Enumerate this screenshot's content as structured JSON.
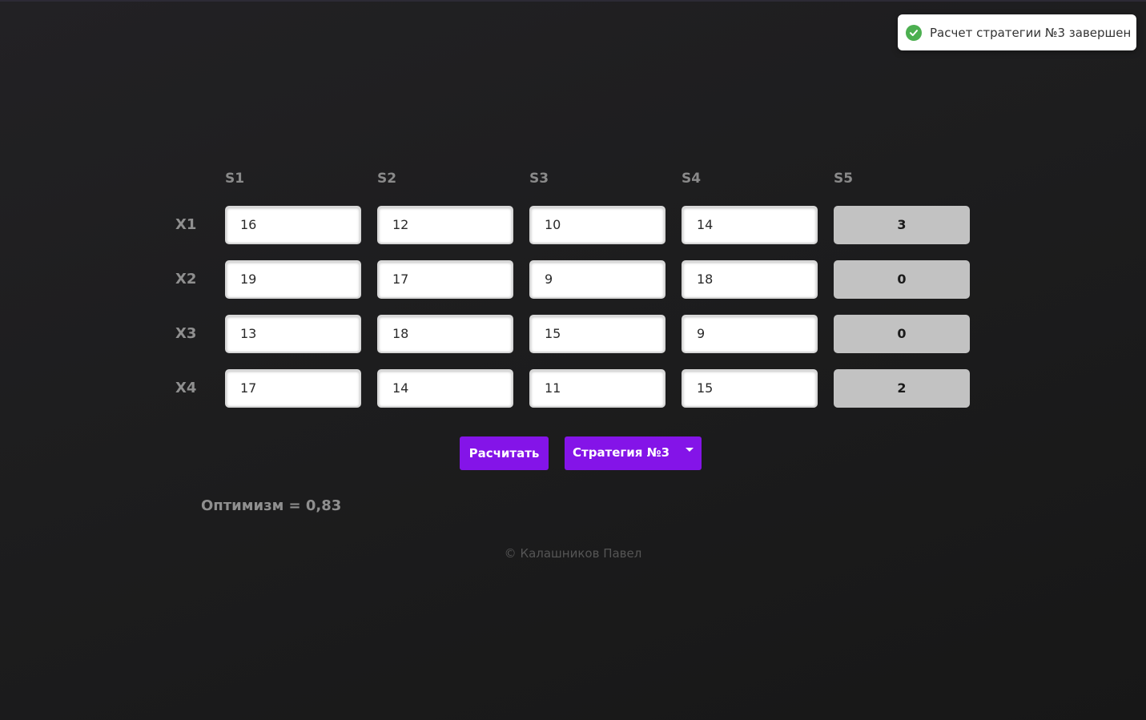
{
  "toast": {
    "message": "Расчет стратегии №3 завершен",
    "icon": "check-circle-icon",
    "icon_color": "#4caf50"
  },
  "matrix": {
    "column_headers": [
      "S1",
      "S2",
      "S3",
      "S4",
      "S5"
    ],
    "rows": [
      {
        "label": "X1",
        "values": [
          "16",
          "12",
          "10",
          "14"
        ],
        "result": "3"
      },
      {
        "label": "X2",
        "values": [
          "19",
          "17",
          "9",
          "18"
        ],
        "result": "0"
      },
      {
        "label": "X3",
        "values": [
          "13",
          "18",
          "15",
          "9"
        ],
        "result": "0"
      },
      {
        "label": "X4",
        "values": [
          "17",
          "14",
          "11",
          "15"
        ],
        "result": "2"
      }
    ]
  },
  "actions": {
    "calculate_label": "Расчитать",
    "strategy_selected": "Стратегия №3",
    "accent_color": "#8414e8"
  },
  "optimism_text": "Оптимизм = 0,83",
  "footer_text": "© Калашников Павел"
}
